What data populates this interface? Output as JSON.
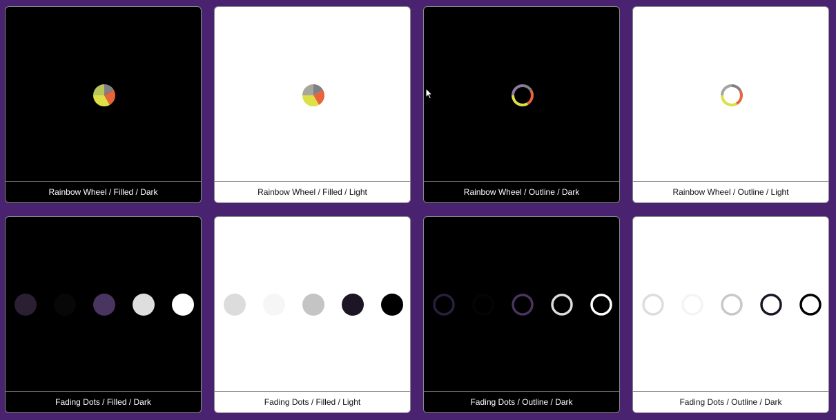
{
  "cards": [
    {
      "label": "Rainbow Wheel / Filled / Dark",
      "theme": "dark",
      "kind": "wheel-filled"
    },
    {
      "label": "Rainbow Wheel / Filled / Light",
      "theme": "light",
      "kind": "wheel-filled"
    },
    {
      "label": "Rainbow Wheel / Outline / Dark",
      "theme": "dark",
      "kind": "wheel-outline"
    },
    {
      "label": "Rainbow Wheel / Outline / Light",
      "theme": "light",
      "kind": "wheel-outline"
    },
    {
      "label": "Fading Dots / Filled / Dark",
      "theme": "dark",
      "kind": "dots-filled"
    },
    {
      "label": "Fading Dots / Filled / Light",
      "theme": "light",
      "kind": "dots-filled"
    },
    {
      "label": "Fading Dots / Outline / Dark",
      "theme": "dark",
      "kind": "dots-outline"
    },
    {
      "label": "Fading Dots / Outline / Dark",
      "theme": "light",
      "kind": "dots-outline"
    }
  ],
  "colors": {
    "background": "#4a2370",
    "wheel_gray": "#7f7f86",
    "wheel_orange": "#e8643a",
    "wheel_yellow": "#dde046",
    "dot_purple": "#4a3460"
  },
  "icons": {
    "cursor": "mouse-pointer-icon"
  }
}
